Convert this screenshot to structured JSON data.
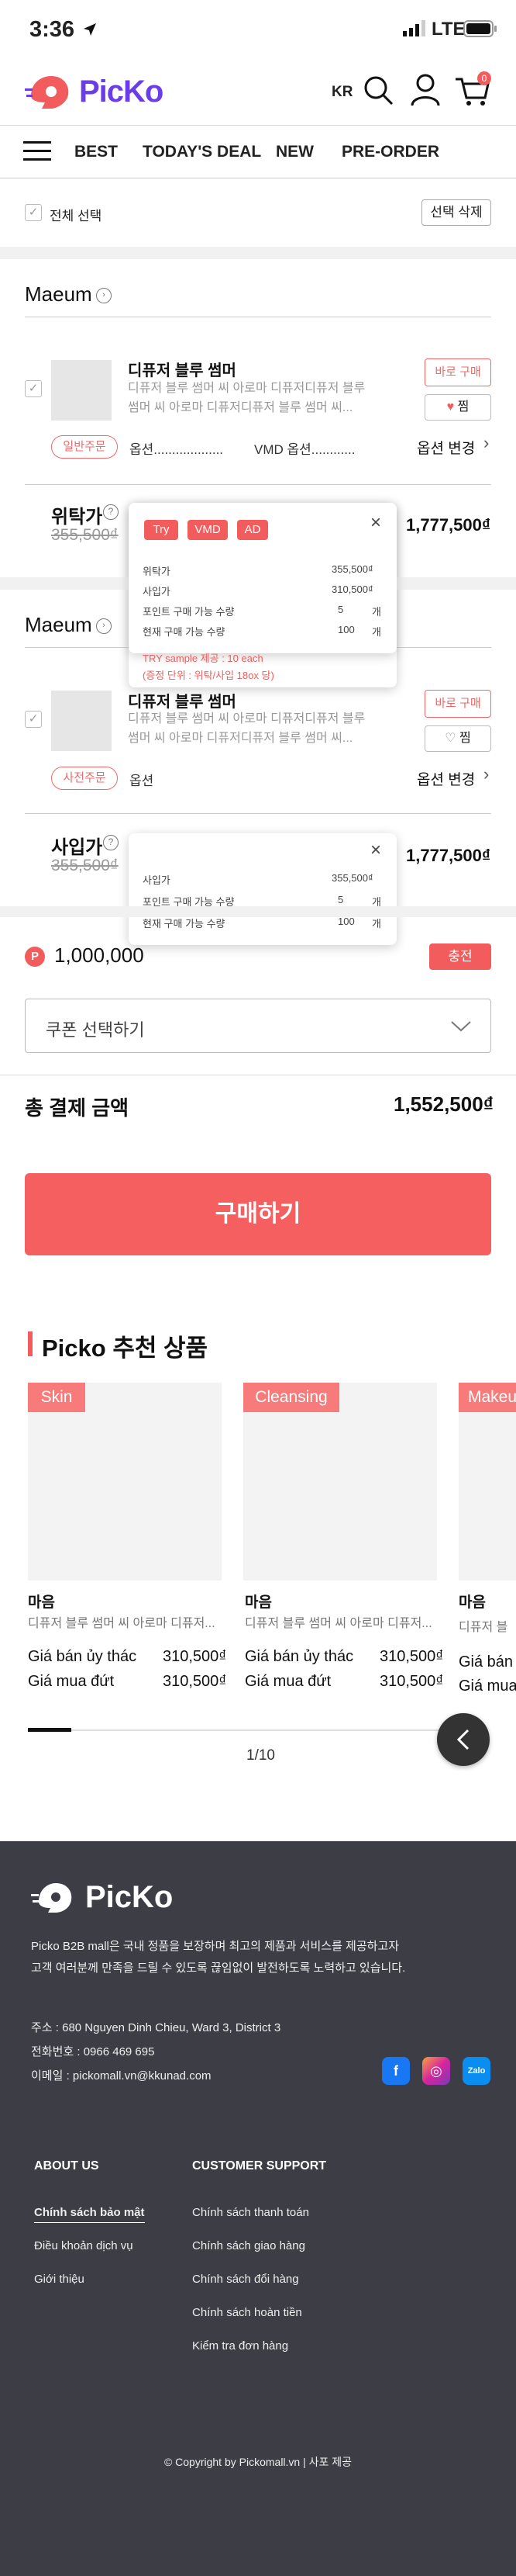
{
  "status_bar": {
    "time": "3:36",
    "network": "LTE"
  },
  "header": {
    "brand": "PicKo",
    "language": "KR",
    "cart_badge": "0"
  },
  "nav": {
    "items": [
      "BEST",
      "TODAY'S DEAL",
      "NEW",
      "PRE-ORDER"
    ]
  },
  "cart_toolbar": {
    "select_all": "전체 선택",
    "delete_selected": "선택 삭제"
  },
  "sellers": [
    {
      "name": "Maeum",
      "product": {
        "name": "디퓨저 블루 썸머",
        "desc_line1": "디퓨저 블루 썸머 씨 아로마 디퓨저디퓨저 블루",
        "desc_line2": "썸머 씨 아로마 디퓨저디퓨저 블루 썸머 씨...",
        "order_type": "일반주문",
        "option": "옵션...................",
        "vmd_option": "VMD 옵션............",
        "change_option": "옵션 변경",
        "buy_now": "바로 구매",
        "wish": "찜"
      },
      "price_label": "위탁가",
      "price_original": "355,500₫",
      "price_total": "1,777,500₫",
      "popup": {
        "tags": [
          "Try",
          "VMD",
          "AD"
        ],
        "rows": [
          {
            "label": "위탁가",
            "value": "355,500₫"
          },
          {
            "label": "사입가",
            "value": "310,500₫"
          },
          {
            "label": "포인트 구매 가능 수량",
            "value": "5",
            "unit": "개"
          },
          {
            "label": "현재 구매 가능 수량",
            "value": "100",
            "unit": "개"
          }
        ],
        "note_line1": "TRY sample 제공 : 10 each",
        "note_line2": "(증정 단위 : 위탁/사입 18ox 당)"
      }
    },
    {
      "name": "Maeum",
      "product": {
        "name": "디퓨저 블루 썸머",
        "desc_line1": "디퓨저 블루 썸머 씨 아로마 디퓨저디퓨저 블루",
        "desc_line2": "썸머 씨 아로마 디퓨저디퓨저 블루 썸머 씨...",
        "order_type": "사전주문",
        "option": "옵션",
        "change_option": "옵션 변경",
        "buy_now": "바로 구매",
        "wish": "찜"
      },
      "price_label": "사입가",
      "price_original": "355,500₫",
      "price_total": "1,777,500₫",
      "popup": {
        "rows": [
          {
            "label": "사입가",
            "value": "355,500₫"
          },
          {
            "label": "포인트 구매 가능 수량",
            "value": "5",
            "unit": "개"
          },
          {
            "label": "현재 구매 가능 수량",
            "value": "100",
            "unit": "개"
          }
        ]
      }
    }
  ],
  "points": {
    "badge": "P",
    "amount": "1,000,000",
    "charge": "충전"
  },
  "coupon": {
    "placeholder": "쿠폰 선택하기"
  },
  "total": {
    "label": "총 결제 금액",
    "value": "1,552,500₫"
  },
  "purchase_button": "구매하기",
  "recommend": {
    "title": "Picko 추천 상품",
    "cards": [
      {
        "tag": "Skin",
        "brand": "마음",
        "desc": "디퓨저 블루 썸머 씨 아로마 디퓨저...",
        "consign_label": "Giá bán ủy thác",
        "consign_price": "310,500₫",
        "buy_label": "Giá mua đứt",
        "buy_price": "310,500₫"
      },
      {
        "tag": "Cleansing",
        "brand": "마음",
        "desc": "디퓨저 블루 썸머 씨 아로마 디퓨저...",
        "consign_label": "Giá bán ủy thác",
        "consign_price": "310,500₫",
        "buy_label": "Giá mua đứt",
        "buy_price": "310,500₫"
      },
      {
        "tag": "Makeu",
        "brand": "마음",
        "desc": "디퓨저 블",
        "consign_label": "Giá bán",
        "consign_price": "",
        "buy_label": "Giá mua",
        "buy_price": ""
      }
    ],
    "pager": "1/10",
    "progress": 0.1
  },
  "footer": {
    "brand": "PicKo",
    "intro_line1": "Picko B2B mall은 국내 정품을 보장하며 최고의 제품과 서비스를 제공하고자",
    "intro_line2": "고객 여러분께 만족을 드릴 수 있도록 끊임없이 발전하도록 노력하고 있습니다.",
    "address": "주소 : 680 Nguyen Dinh Chieu, Ward 3, District 3",
    "phone": "전화번호 : 0966 469 695",
    "email": "이메일 : pickomall.vn@kkunad.com",
    "about_title": "ABOUT US",
    "about_links": [
      "Chính sách bảo mật",
      "Điều khoản dịch vụ",
      "Giới thiệu"
    ],
    "support_title": "CUSTOMER SUPPORT",
    "support_links": [
      "Chính sách thanh toán",
      "Chính sách giao hàng",
      "Chính sách đổi hàng",
      "Chính sách hoàn tiền",
      "Kiểm tra đơn hàng"
    ],
    "copyright": "© Copyright by Pickomall.vn | 사포 제공",
    "social": {
      "zalo": "Zalo"
    }
  },
  "colors": {
    "brand_purple": "#6a3de8",
    "accent_red": "#f25c5c",
    "footer_bg": "#3d3d45"
  }
}
